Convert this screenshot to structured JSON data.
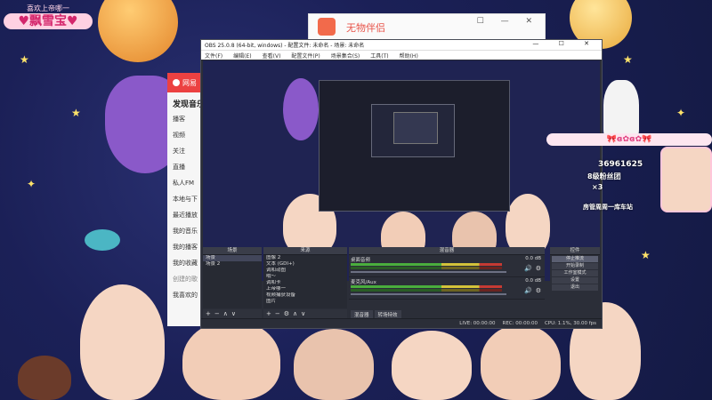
{
  "colors": {
    "desktop_bg": "#1b2057",
    "obs_bg": "#2b2e38",
    "music_accent": "#ec4141",
    "badge_pink": "#ffd1e2"
  },
  "badge": {
    "top": "喜欢上帝哪一",
    "main": "♥飘雪宝♥"
  },
  "popup": {
    "title": "无物伴侣",
    "controls": "☐ — ✕"
  },
  "music": {
    "header": "网易",
    "section": "发现音乐",
    "items": [
      "播客",
      "视频",
      "关注",
      "直播",
      "私人FM"
    ],
    "sub_items": [
      "本地与下",
      "最近播放",
      "我的音乐",
      "我的播客",
      "我的收藏"
    ],
    "section2": "创建的歌",
    "item_last": "我喜欢的"
  },
  "obs": {
    "title": "OBS 25.0.8 (64-bit, windows) - 配置文件: 未命名 - 场景: 未命名",
    "controls": "— ☐ ✕",
    "menu": [
      "文件(F)",
      "编辑(E)",
      "查看(V)",
      "配置文件(P)",
      "场景集合(S)",
      "工具(T)",
      "帮助(H)"
    ],
    "scenes_title": "场景",
    "scenes": [
      "场景",
      "场景 2"
    ],
    "sources_title": "来源",
    "sources": [
      "图像 2",
      "文本 (GDI+)",
      "调和动图",
      "哦～",
      "调和卡",
      "上帝哪一",
      "视频捕获设备",
      "图片"
    ],
    "mixer_title": "混音器",
    "mixer": [
      {
        "name": "桌面音频",
        "vol": "0.0 dB"
      },
      {
        "name": "麦克风/Aux",
        "vol": "0.0 dB"
      }
    ],
    "controls_title": "控件",
    "buttons": [
      "停止推流",
      "开始录制",
      "工作室模式",
      "设置",
      "退出"
    ],
    "tabs": [
      "混音器",
      "转场特效"
    ],
    "status": [
      "LIVE: 00:00:00",
      "REC: 00:00:00",
      "CPU: 1.1%, 30.00 fps"
    ]
  },
  "overlay": {
    "title": "🎀ɞ✿ɞ✿🎀",
    "fans": "36961625",
    "fans_label": "8级粉丝团",
    "x3": "×3",
    "note": "房管周周一库车站"
  }
}
